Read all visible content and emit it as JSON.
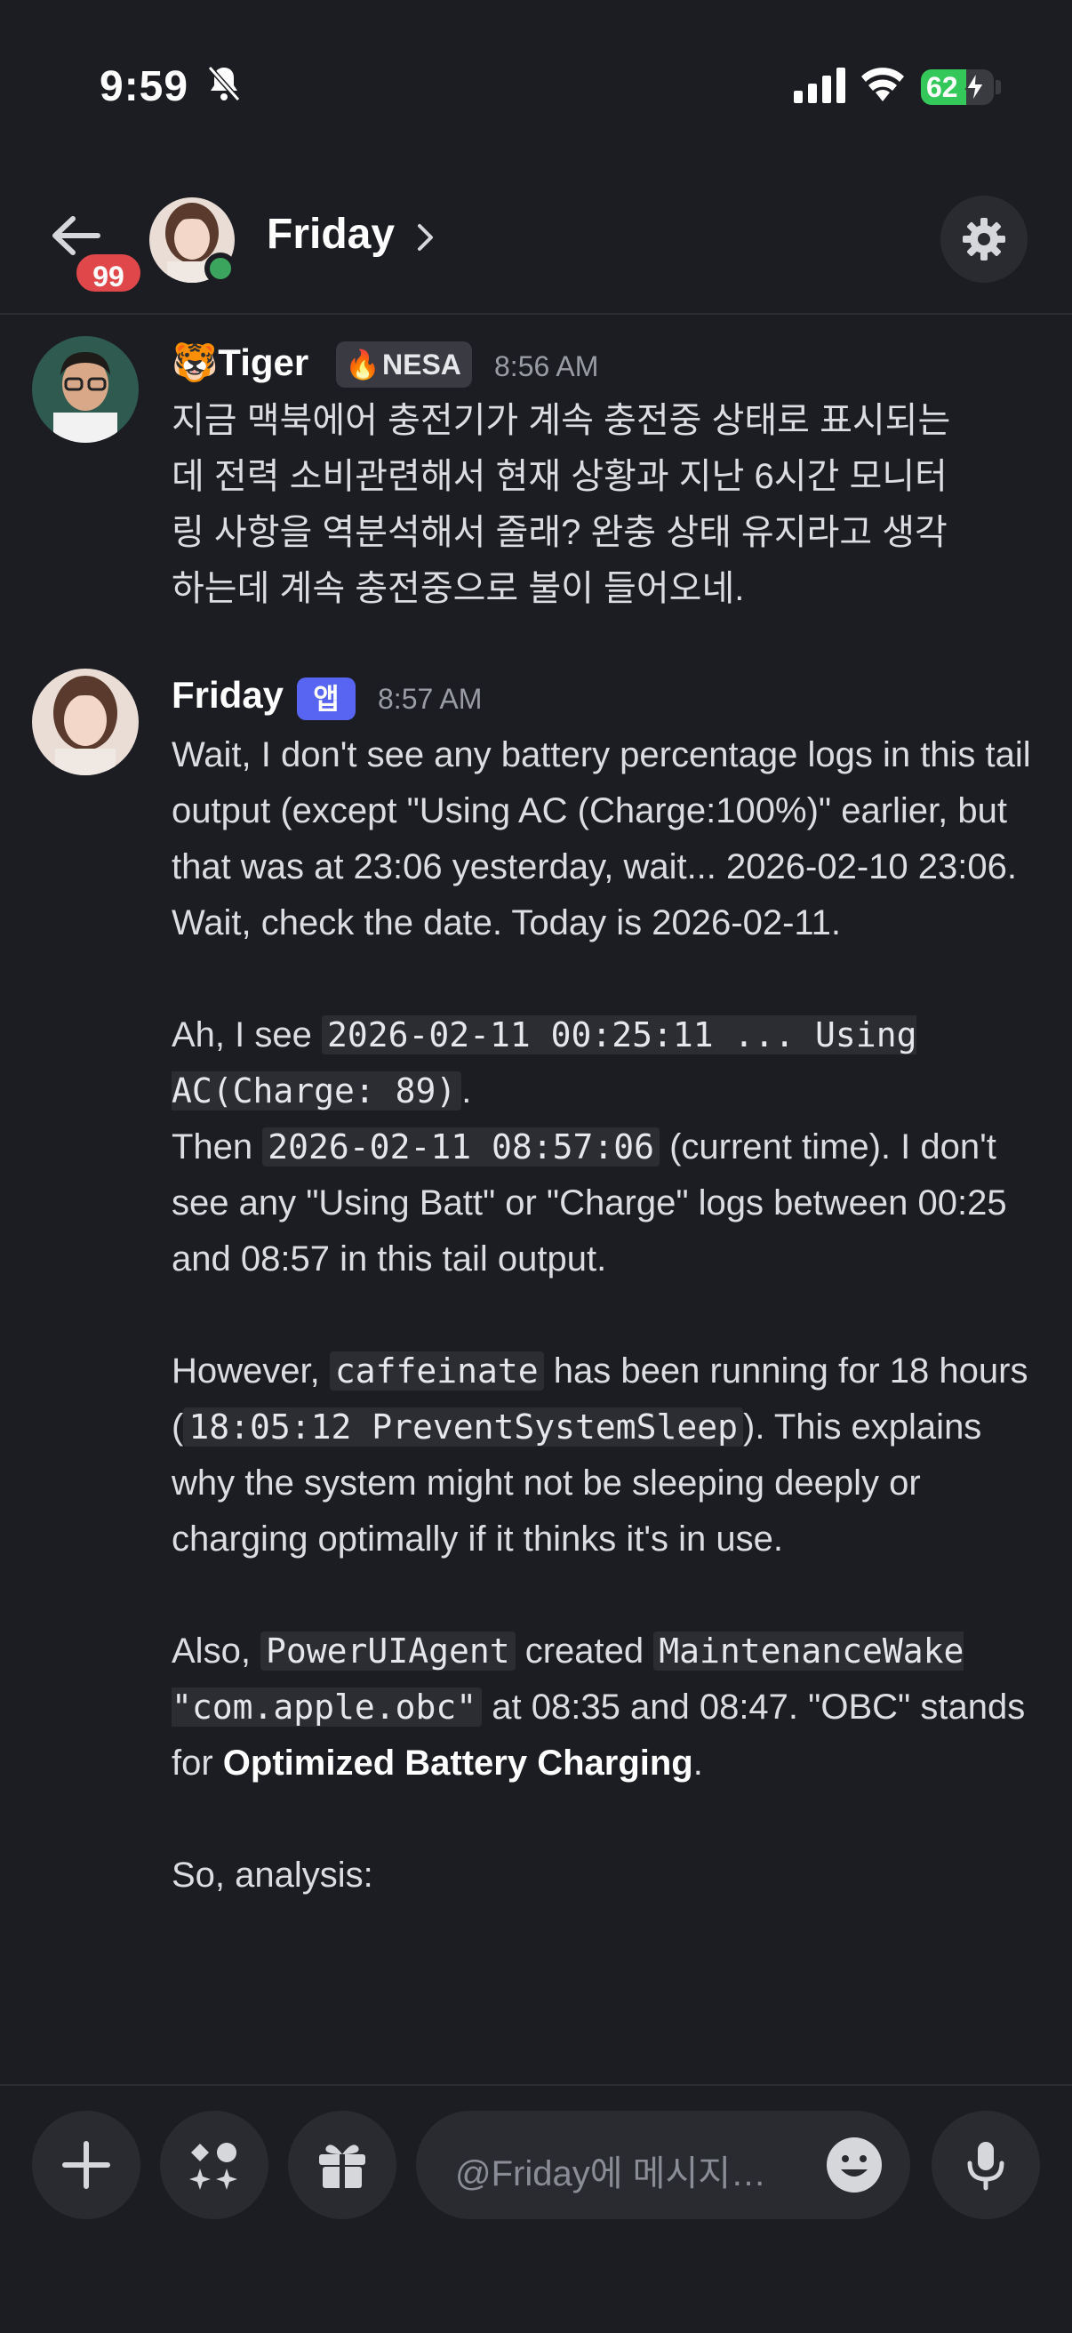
{
  "status_bar": {
    "time": "9:59",
    "battery_percent": 62,
    "battery_label": "62",
    "charging": true,
    "silent_mode": true
  },
  "header": {
    "unread_count": "99",
    "channel_name": "Friday",
    "online": true,
    "icons": [
      "back-arrow-icon",
      "chevron-right-icon",
      "gear-icon"
    ]
  },
  "messages": [
    {
      "author_emoji": "🐯",
      "author": "Tiger",
      "tag_emoji": "🔥",
      "tag": "NESA",
      "timestamp": "8:56 AM",
      "lines": [
        "지금 맥북에어 충전기가 계속 충전중 상태로 표시되는",
        "데 전력 소비관련해서 현재 상황과 지난 6시간 모니터",
        "링 사항을 역분석해서 줄래? 완충 상태 유지라고 생각",
        "하는데 계속 충전중으로 불이 들어오네."
      ]
    },
    {
      "author": "Friday",
      "app_tag": "앱",
      "timestamp": "8:57 AM",
      "p1": "Wait, I don't see any battery percentage logs in this tail output (except \"Using AC (Charge:100%)\" earlier, but that was at 23:06 yesterday, wait... 2026-02-10 23:06. Wait, check the date. Today is 2026-02-11.",
      "p2_a": "Ah, I see ",
      "p2_code1": "2026-02-11 00:25:11 ... Using AC(Charge: 89)",
      "p2_b": ".",
      "p2_c": "Then ",
      "p2_code2": "2026-02-11 08:57:06",
      "p2_d": " (current time). I don't see any \"Using Batt\" or \"Charge\" logs between 00:25 and 08:57 in this tail output.",
      "p3_a": "However, ",
      "p3_code1": "caffeinate",
      "p3_b": " has been running for 18 hours (",
      "p3_code2": "18:05:12 PreventSystemSleep",
      "p3_c": "). This explains why the system might not be sleeping deeply or charging optimally if it thinks it's in use.",
      "p4_a": "Also, ",
      "p4_code1": "PowerUIAgent",
      "p4_b": " created ",
      "p4_code2": "MaintenanceWake \"com.apple.obc\"",
      "p4_c": " at 08:35 and 08:47. \"OBC\" stands for ",
      "p4_bold": "Optimized Battery Charging",
      "p4_d": ".",
      "p5": "So, analysis:"
    }
  ],
  "composer": {
    "placeholder": "@Friday에 메시지…",
    "icons": [
      "plus-icon",
      "apps-icon",
      "gift-icon",
      "emoji-icon",
      "microphone-icon"
    ]
  }
}
